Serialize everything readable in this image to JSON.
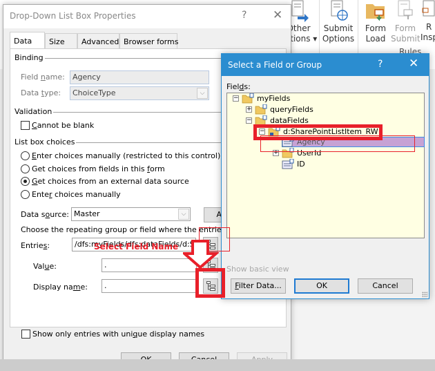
{
  "ribbon": {
    "buttons": [
      {
        "line1": "Other",
        "line2": "Actions ▾",
        "icon": "other-actions-icon"
      },
      {
        "line1": "Submit",
        "line2": "Options",
        "icon": "submit-options-icon"
      },
      {
        "line1": "Form",
        "line2": "Load",
        "icon": "form-load-icon"
      },
      {
        "line1": "Form",
        "line2": "Submit",
        "icon": "form-submit-icon",
        "disabled": true
      },
      {
        "line1": "R",
        "line2": "Insp",
        "icon": "rule-inspector-icon"
      }
    ],
    "group_label": "Rules"
  },
  "main_dialog": {
    "title": "Drop-Down List Box Properties",
    "help": "?",
    "close": "✕",
    "tabs": [
      {
        "label": "Data",
        "active": true
      },
      {
        "label": "Size"
      },
      {
        "label": "Advanced"
      },
      {
        "label": "Browser forms"
      }
    ],
    "binding": {
      "title": "Binding",
      "field_name_label_pre": "Field ",
      "field_name_label_u": "n",
      "field_name_label_post": "ame:",
      "field_name_value": "Agency",
      "data_type_label_pre": "Data ",
      "data_type_label_u": "t",
      "data_type_label_post": "ype:",
      "data_type_value": "ChoiceType"
    },
    "validation": {
      "title": "Validation",
      "cannot_be_blank_u": "C",
      "cannot_be_blank_rest": "annot be blank",
      "cannot_be_blank_checked": false
    },
    "list_box_choices": {
      "title": "List box choices",
      "options": [
        {
          "u": "E",
          "rest": "nter choices manually (restricted to this control)",
          "selected": false
        },
        {
          "pre": "Get choices from fields in this ",
          "u": "f",
          "rest": "orm",
          "selected": false
        },
        {
          "u": "G",
          "rest": "et choices from an external data source",
          "selected": true
        },
        {
          "pre": "Ente",
          "u": "r",
          "rest": " choices manually",
          "selected": false
        }
      ]
    },
    "data_source_label_pre": "Data s",
    "data_source_label_u": "o",
    "data_source_label_post": "urce:",
    "data_source_value": "Master",
    "add_button": "A",
    "choose_text": "Choose the repeating group or field where the entries are stored.",
    "entries_label_pre": "Entrie",
    "entries_label_u": "s",
    "entries_label_post": ":",
    "entries_value": "/dfs:myFields/dfs:dataFields/d:SharePointListItem_RW",
    "value_label_pre": "Val",
    "value_label_u": "u",
    "value_label_post": "e:",
    "value_value": ".",
    "display_name_label_pre": "Display na",
    "display_name_label_u": "m",
    "display_name_label_post": "e:",
    "display_name_value": ".",
    "unique_pre": "Show only entries with uni",
    "unique_u": "q",
    "unique_post": "ue display names",
    "unique_checked": false,
    "ok": "OK",
    "cancel": "Cancel",
    "apply": "Apply"
  },
  "select_dialog": {
    "title": "Select a Field or Group",
    "help": "?",
    "close": "✕",
    "fields_label_pre": "Fiel",
    "fields_label_u": "d",
    "fields_label_post": "s:",
    "tree": [
      {
        "label": "myFields",
        "expander": "−",
        "type": "group",
        "level": 0
      },
      {
        "label": "queryFields",
        "expander": "+",
        "type": "group",
        "level": 1
      },
      {
        "label": "dataFields",
        "expander": "−",
        "type": "group",
        "level": 1
      },
      {
        "label": "d:SharePointListItem_RW",
        "expander": "−",
        "type": "repeating-group",
        "level": 2
      },
      {
        "label": "Agency",
        "expander": "",
        "type": "field",
        "level": 3,
        "selected": true
      },
      {
        "label": "UserId",
        "expander": "+",
        "type": "group",
        "level": 3
      },
      {
        "label": "ID",
        "expander": "",
        "type": "field",
        "level": 3
      }
    ],
    "show_basic_view": "Show basic view",
    "filter_data_u": "F",
    "filter_data_rest": "ilter Data...",
    "ok": "OK",
    "cancel": "Cancel"
  },
  "annotation": {
    "text": "Select Field Name",
    "color": "#e8202a"
  }
}
